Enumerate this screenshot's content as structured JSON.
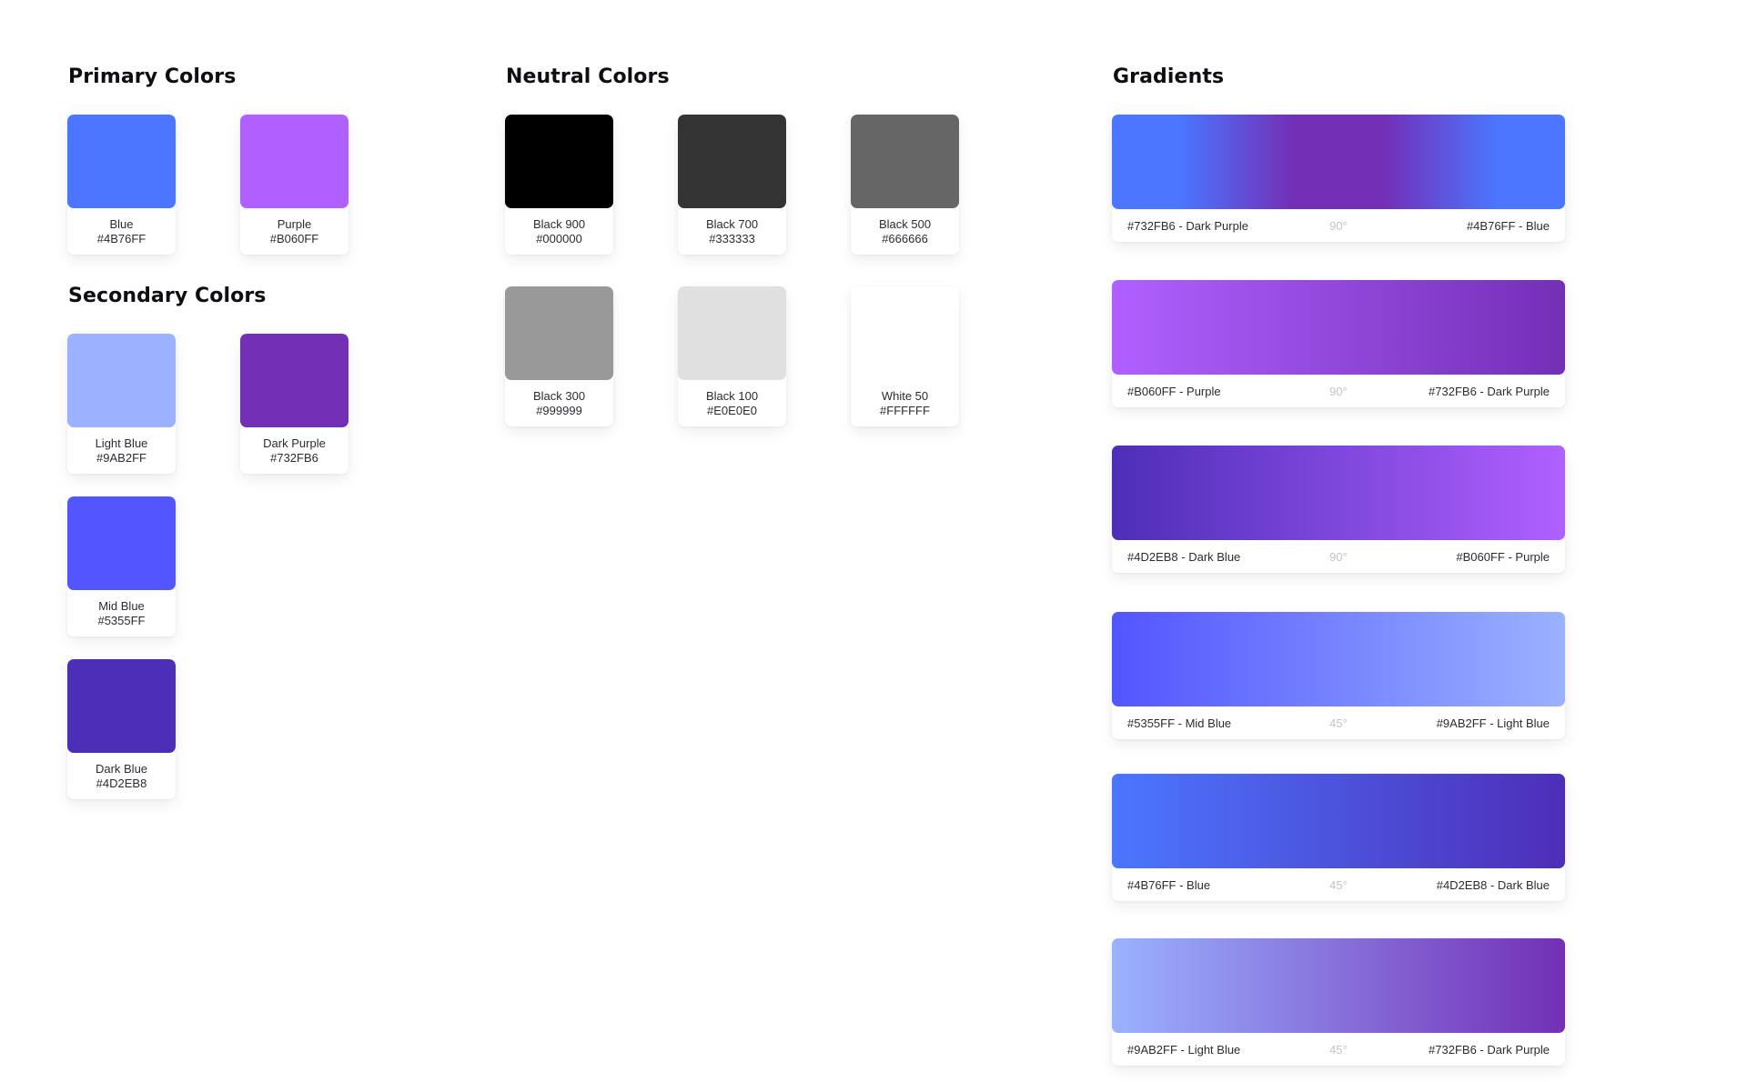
{
  "primary": {
    "title": "Primary Colors",
    "swatches": [
      {
        "name": "Blue",
        "hex": "#4B76FF",
        "color": "#4B76FF"
      },
      {
        "name": "Purple",
        "hex": "#B060FF",
        "color": "#B060FF"
      }
    ]
  },
  "secondary": {
    "title": "Secondary Colors",
    "swatches": [
      {
        "name": "Light Blue",
        "hex": "#9AB2FF",
        "color": "#9AB2FF"
      },
      {
        "name": "Dark Purple",
        "hex": "#732FB6",
        "color": "#732FB6"
      },
      {
        "name": "Mid Blue",
        "hex": "#5355FF",
        "color": "#5355FF"
      },
      {
        "name": "Dark Blue",
        "hex": "#4D2EB8",
        "color": "#4D2EB8"
      }
    ]
  },
  "neutral": {
    "title": "Neutral Colors",
    "swatches": [
      {
        "name": "Black 900",
        "hex": "#000000",
        "color": "#000000"
      },
      {
        "name": "Black 700",
        "hex": "#333333",
        "color": "#333333"
      },
      {
        "name": "Black 500",
        "hex": "#666666",
        "color": "#666666"
      },
      {
        "name": "Black 300",
        "hex": "#999999",
        "color": "#999999"
      },
      {
        "name": "Black 100",
        "hex": "#E0E0E0",
        "color": "#E0E0E0"
      },
      {
        "name": "White 50",
        "hex": "#FFFFFF",
        "color": "#FFFFFF"
      }
    ]
  },
  "gradients": {
    "title": "Gradients",
    "items": [
      {
        "left": "#732FB6 - Dark Purple",
        "angle": "90°",
        "right": "#4B76FF - Blue"
      },
      {
        "left": "#B060FF - Purple",
        "angle": "90°",
        "right": "#732FB6 - Dark Purple"
      },
      {
        "left": "#4D2EB8 - Dark Blue",
        "angle": "90°",
        "right": "#B060FF - Purple"
      },
      {
        "left": "#5355FF - Mid Blue",
        "angle": "45°",
        "right": "#9AB2FF - Light Blue"
      },
      {
        "left": "#4B76FF - Blue",
        "angle": "45°",
        "right": "#4D2EB8 - Dark Blue"
      },
      {
        "left": "#9AB2FF - Light Blue",
        "angle": "45°",
        "right": "#732FB6 - Dark Purple"
      }
    ]
  }
}
